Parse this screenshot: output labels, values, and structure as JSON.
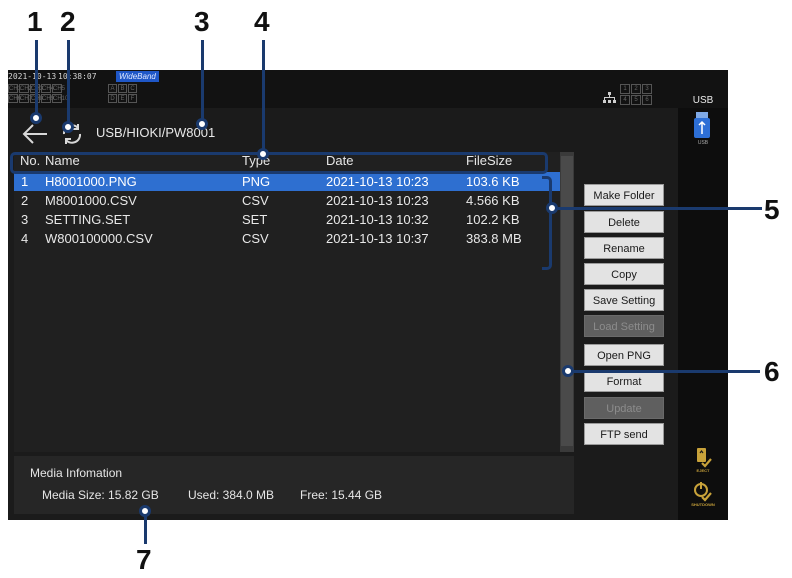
{
  "callouts": [
    "1",
    "2",
    "3",
    "4",
    "5",
    "6",
    "7"
  ],
  "status_bar": {
    "date": "2021-10-13",
    "time": "10:38:07",
    "mode_badge": "WideBand",
    "channel_grid_left": [
      "CH1",
      "CH2",
      "CH3",
      "CH4",
      "CH5",
      "CH6",
      "CH7",
      "CH8",
      "CH9",
      "CH10"
    ],
    "channel_grid_mid": [
      "A",
      "B",
      "C",
      "D",
      "E",
      "F"
    ],
    "channel_grid_right": [
      "1",
      "2",
      "3",
      "4",
      "5",
      "6"
    ],
    "network_icon": "network-icon",
    "media_tab_label": "USB"
  },
  "path_bar": {
    "back_icon": "back-arrow-icon",
    "refresh_icon": "refresh-icon",
    "path": "USB/HIOKI/PW8001"
  },
  "file_table": {
    "columns": [
      "No.",
      "Name",
      "Type",
      "Date",
      "FileSize"
    ],
    "rows": [
      {
        "no": "1",
        "name": "H8001000.PNG",
        "type": "PNG",
        "date": "2021-10-13 10:23",
        "size": "103.6 KB",
        "selected": true
      },
      {
        "no": "2",
        "name": "M8001000.CSV",
        "type": "CSV",
        "date": "2021-10-13 10:23",
        "size": "4.566 KB",
        "selected": false
      },
      {
        "no": "3",
        "name": "SETTING.SET",
        "type": "SET",
        "date": "2021-10-13 10:32",
        "size": "102.2 KB",
        "selected": false
      },
      {
        "no": "4",
        "name": "W800100000.CSV",
        "type": "CSV",
        "date": "2021-10-13 10:37",
        "size": "383.8 MB",
        "selected": false
      }
    ]
  },
  "buttons": [
    {
      "label": "Make Folder",
      "enabled": true
    },
    {
      "label": "Delete",
      "enabled": true
    },
    {
      "label": "Rename",
      "enabled": true
    },
    {
      "label": "Copy",
      "enabled": true
    },
    {
      "label": "Save Setting",
      "enabled": true
    },
    {
      "label": "Load Setting",
      "enabled": false
    },
    {
      "label": "Open PNG",
      "enabled": true
    },
    {
      "label": "Format",
      "enabled": true
    },
    {
      "label": "Update",
      "enabled": false
    },
    {
      "label": "FTP send",
      "enabled": true
    }
  ],
  "media_info": {
    "title": "Media Infomation",
    "media_size": "Media Size: 15.82 GB",
    "used": "Used: 384.0 MB",
    "free": "Free: 15.44 GB"
  },
  "side_panel": {
    "usb_device_icon": "usb-drive-icon",
    "usb_device_label": "USB",
    "eject_icon": "eject-icon",
    "eject_label": "EJECT",
    "shutdown_icon": "shutdown-icon",
    "shutdown_label": "SHUTDOWN"
  },
  "colors": {
    "selection": "#2e6fd0",
    "callout_line": "#1a3a6e",
    "badge": "#1f57c7",
    "accent_gold": "#c8a23a"
  }
}
